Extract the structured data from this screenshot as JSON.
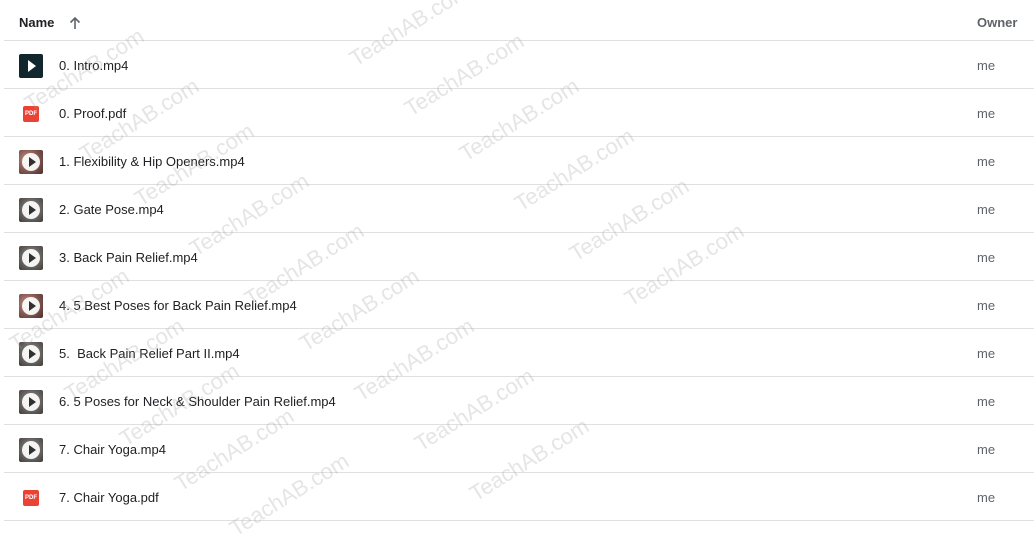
{
  "header": {
    "name_label": "Name",
    "owner_label": "Owner",
    "sort": "ascending"
  },
  "files": [
    {
      "name": "0. Intro.mp4",
      "owner": "me",
      "type": "video",
      "thumb": "dark"
    },
    {
      "name": "0. Proof.pdf",
      "owner": "me",
      "type": "pdf",
      "thumb": "pdf"
    },
    {
      "name": "1. Flexibility & Hip Openers.mp4",
      "owner": "me",
      "type": "video",
      "thumb": "warm"
    },
    {
      "name": "2. Gate Pose.mp4",
      "owner": "me",
      "type": "video",
      "thumb": "gray"
    },
    {
      "name": "3. Back Pain Relief.mp4",
      "owner": "me",
      "type": "video",
      "thumb": "gray"
    },
    {
      "name": "4. 5 Best Poses for Back Pain Relief.mp4",
      "owner": "me",
      "type": "video",
      "thumb": "warm"
    },
    {
      "name": "5.  Back Pain Relief Part II.mp4",
      "owner": "me",
      "type": "video",
      "thumb": "gray"
    },
    {
      "name": "6. 5 Poses for Neck & Shoulder Pain Relief.mp4",
      "owner": "me",
      "type": "video",
      "thumb": "gray"
    },
    {
      "name": "7. Chair Yoga.mp4",
      "owner": "me",
      "type": "video",
      "thumb": "gray"
    },
    {
      "name": "7. Chair Yoga.pdf",
      "owner": "me",
      "type": "pdf",
      "thumb": "pdf"
    }
  ],
  "pdf_badge_text": "PDF",
  "watermark_text": "TeachAB.com",
  "colors": {
    "pdf_red": "#ea4335",
    "divider": "#e0e0e0",
    "text_primary": "#202124",
    "text_secondary": "#5f6368"
  }
}
